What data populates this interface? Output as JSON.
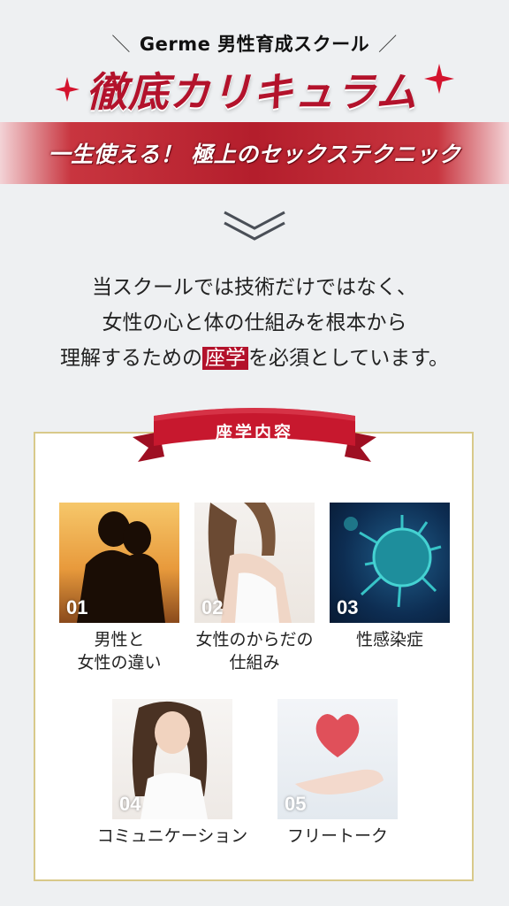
{
  "header": {
    "school": "Germe 男性育成スクール",
    "slash_left": "＼",
    "slash_right": "／",
    "title": "徹底カリキュラム",
    "banner": "一生使える！ 極上のセックステクニック"
  },
  "intro": {
    "line1": "当スクールでは技術だけではなく、",
    "line2": "女性の心と体の仕組みを根本から",
    "line3_before": "理解するための",
    "line3_highlight": "座学",
    "line3_after": "を必須としています。"
  },
  "section": {
    "ribbon_label": "座学内容"
  },
  "courses": [
    {
      "num": "01",
      "label": "男性と\n女性の違い",
      "image": "couple-silhouette-image"
    },
    {
      "num": "02",
      "label": "女性のからだの\n仕組み",
      "image": "woman-portrait-image"
    },
    {
      "num": "03",
      "label": "性感染症",
      "image": "virus-image"
    },
    {
      "num": "04",
      "label": "コミュニケーション",
      "image": "smiling-woman-image"
    },
    {
      "num": "05",
      "label": "フリートーク",
      "image": "heart-in-hand-image"
    }
  ],
  "colors": {
    "accent": "#b3122b",
    "frame": "#d8c98a",
    "background": "#eef0f2"
  }
}
